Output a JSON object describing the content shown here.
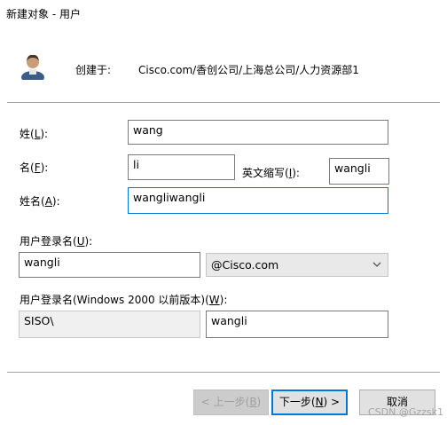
{
  "window": {
    "title": "新建对象 - 用户"
  },
  "header": {
    "created_in_label": "创建于:",
    "created_in_path": "Cisco.com/香创公司/上海总公司/人力资源部1"
  },
  "form": {
    "last_name": {
      "label_pre": "姓(",
      "accel": "L",
      "label_post": "):",
      "value": "wang"
    },
    "first_name": {
      "label_pre": "名(",
      "accel": "F",
      "label_post": "):",
      "value": "li"
    },
    "initials": {
      "label_pre": "英文缩写(",
      "accel": "I",
      "label_post": "):",
      "value": "wangli"
    },
    "full_name": {
      "label_pre": "姓名(",
      "accel": "A",
      "label_post": "):",
      "value": "wangliwangli"
    },
    "logon_name": {
      "label_pre": "用户登录名(",
      "accel": "U",
      "label_post": "):",
      "value": "wangli",
      "domain": "@Cisco.com"
    },
    "pre2000": {
      "label_pre": "用户登录名(Windows 2000 以前版本)(",
      "accel": "W",
      "label_post": "):",
      "domain": "SISO\\",
      "value": "wangli"
    }
  },
  "buttons": {
    "back_pre": "< 上一步(",
    "back_accel": "B",
    "back_post": ")",
    "next_pre": "下一步(",
    "next_accel": "N",
    "next_post": ") >",
    "cancel": "取消"
  },
  "watermark": "CSDN @Gzzsk1",
  "icons": {
    "avatar": "user-avatar-icon",
    "dropdown": "chevron-down-icon"
  },
  "colors": {
    "focus": "#0078d7",
    "button_face": "#e1e1e1"
  }
}
